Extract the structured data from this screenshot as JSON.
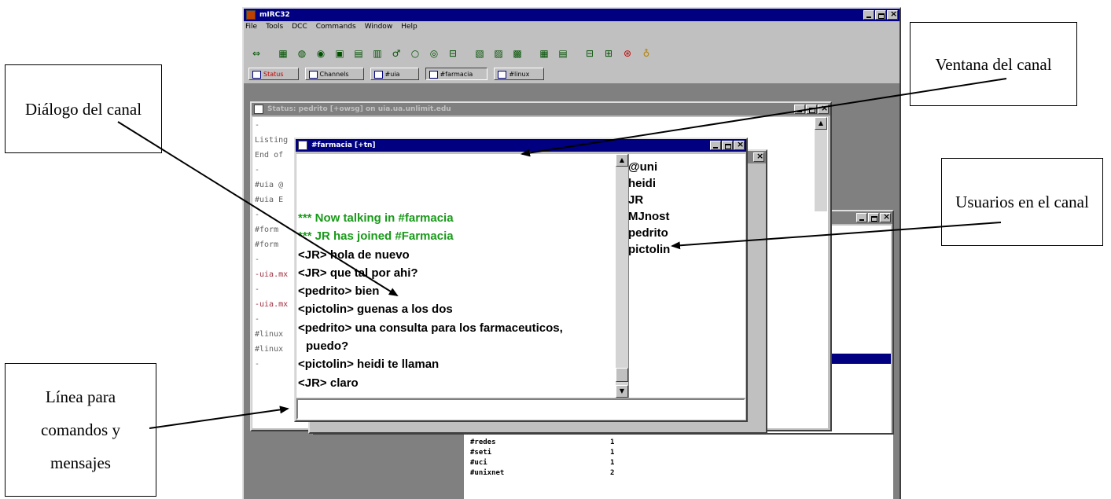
{
  "app": {
    "title": "mIRC32",
    "menu": [
      "File",
      "Tools",
      "DCC",
      "Commands",
      "Window",
      "Help"
    ],
    "switchbar": [
      "Status",
      "Channels",
      "#uia",
      "#farmacia",
      "#linux"
    ]
  },
  "status_window": {
    "title": "Status: pedrito [+owsg] on uia.ua.unlimit.edu",
    "lines": [
      "-",
      "Listing",
      "End of",
      "-",
      "#uia @",
      "#uia E",
      "-",
      "#form",
      "#form",
      "-",
      "-uia.mx",
      "-",
      "-uia.mx",
      "-",
      "#linux",
      "#linux",
      "-"
    ]
  },
  "channel_window": {
    "title": "#farmacia [+tn]",
    "messages": [
      {
        "text": "*** Now talking in #farmacia",
        "type": "system"
      },
      {
        "text": "*** JR has joined #Farmacia",
        "type": "system"
      },
      {
        "text": "<JR> hola de nuevo",
        "type": "msg"
      },
      {
        "text": "<JR> que tal por ahi?",
        "type": "msg"
      },
      {
        "text": "<pedrito> bien",
        "type": "msg"
      },
      {
        "text": "<pictolin> guenas a los dos",
        "type": "msg"
      },
      {
        "text": "<pedrito> una consulta para los farmaceuticos,",
        "type": "msg"
      },
      {
        "text": "puedo?",
        "type": "cont"
      },
      {
        "text": "<pictolin> heidi te llaman",
        "type": "msg"
      },
      {
        "text": "<JR> claro",
        "type": "msg"
      }
    ],
    "nicklist": [
      "@uni",
      "heidi",
      "JR",
      "MJnost",
      "pedrito",
      "pictolin"
    ],
    "input_value": ""
  },
  "list_table": {
    "rows": [
      {
        "name": "#redes",
        "count": "1"
      },
      {
        "name": "#seti",
        "count": "1"
      },
      {
        "name": "#uci",
        "count": "1"
      },
      {
        "name": "#unixnet",
        "count": "2"
      }
    ]
  },
  "annotations": {
    "dialogo": "Diálogo del canal",
    "ventana": "Ventana del canal",
    "usuarios": "Usuarios en el canal",
    "linea": "Línea para comandos y mensajes"
  },
  "colors": {
    "titlebar_active": "#000080",
    "system_message": "#1a9a1a",
    "window_face": "#c0c0c0",
    "mdi_background": "#808080"
  }
}
